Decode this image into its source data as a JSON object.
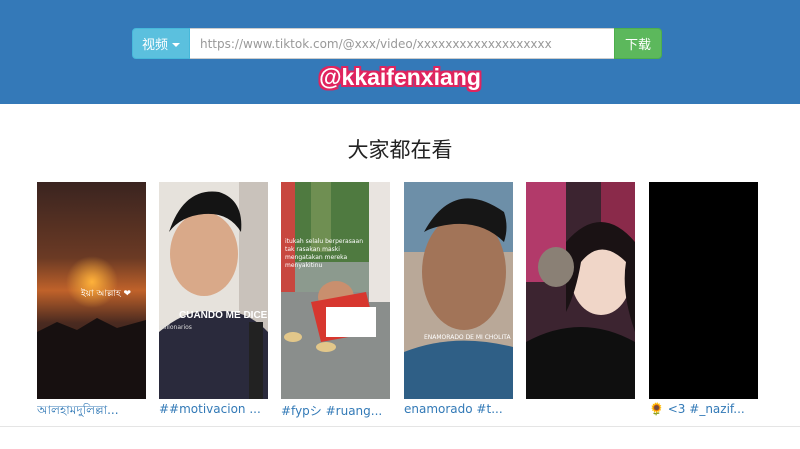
{
  "search": {
    "type_label": "视频",
    "placeholder": "https://www.tiktok.com/@xxx/video/xxxxxxxxxxxxxxxxxxx",
    "download_label": "下载"
  },
  "watermark": "@kkaifenxiang",
  "section": {
    "title": "大家都在看"
  },
  "videos": [
    {
      "caption": "আলহামদুলিল্লা...",
      "overlay": "ইয়া আল্লাহ ❤",
      "colors": {
        "bg": "#4a2c22",
        "accent": "#d9772e"
      }
    },
    {
      "caption": "##motivacion ...",
      "overlay": "CUANDO ME DICEN,",
      "sub": "millonarios",
      "colors": {
        "bg": "#d8d0c8",
        "accent": "#2c2a3a"
      }
    },
    {
      "caption": "#fypシ #ruang...",
      "overlay": "itukah selalu berperasaan tak rasakan maski mengatakan mereka menyakitinu",
      "colors": {
        "bg": "#7f8c86",
        "accent": "#d7372f"
      }
    },
    {
      "caption": "enamorado #t...",
      "overlay": "ENAMORADO DE MI CHOLITA",
      "colors": {
        "bg": "#8a6a58",
        "accent": "#2f5f86"
      }
    },
    {
      "caption": "",
      "colors": {
        "bg": "#3a2028",
        "accent": "#b23a6a"
      }
    },
    {
      "caption": "🌻 <3 #_nazif...",
      "colors": {
        "bg": "#000000",
        "accent": "#000000"
      }
    }
  ]
}
